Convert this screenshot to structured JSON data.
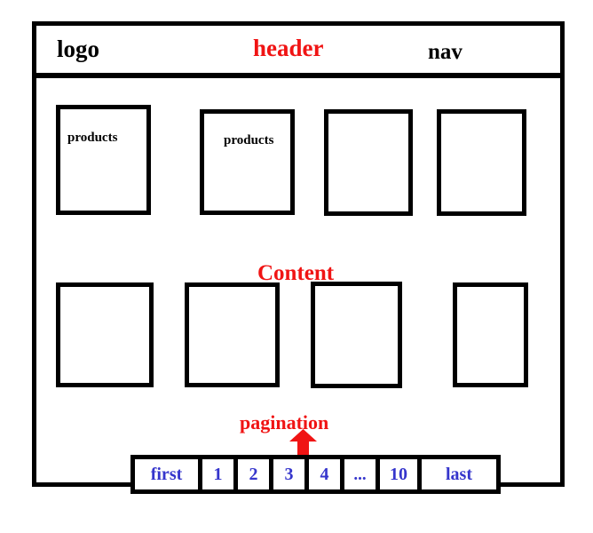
{
  "frame": {
    "header": {
      "logo_label": "logo",
      "title": "header",
      "nav_label": "nav",
      "title_color": "#f01414",
      "logo_color": "#000000"
    },
    "content": {
      "heading": "Content",
      "heading_color": "#f01414",
      "row1": [
        {
          "label": "products"
        },
        {
          "label": "products"
        },
        {
          "label": ""
        },
        {
          "label": ""
        }
      ],
      "row2": [
        {
          "label": ""
        },
        {
          "label": ""
        },
        {
          "label": ""
        },
        {
          "label": ""
        }
      ]
    },
    "pagination": {
      "annotation": "pagination",
      "annotation_color": "#f01414",
      "arrow_icon": "arrow-up-icon",
      "link_color": "#3535cc",
      "items": [
        {
          "label": "first"
        },
        {
          "label": "1"
        },
        {
          "label": "2"
        },
        {
          "label": "3"
        },
        {
          "label": "4"
        },
        {
          "label": "..."
        },
        {
          "label": "10"
        },
        {
          "label": "last"
        }
      ]
    }
  }
}
